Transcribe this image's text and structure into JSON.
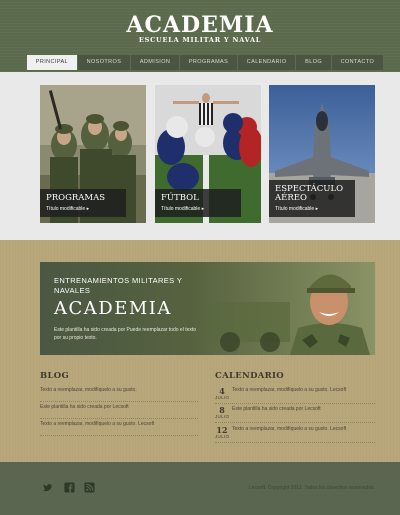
{
  "site": {
    "title": "ACADEMIA",
    "subtitle": "ESCUELA MILITAR Y NAVAL"
  },
  "nav": {
    "items": [
      {
        "label": "PRINCIPAL"
      },
      {
        "label": "NOSOTROS"
      },
      {
        "label": "ADMISION"
      },
      {
        "label": "PROGRAMAS"
      },
      {
        "label": "CALENDARIO"
      },
      {
        "label": "BLOG"
      },
      {
        "label": "CONTACTO"
      }
    ],
    "active_label": "PRINCIPAL"
  },
  "features": [
    {
      "title": "PROGRAMAS",
      "link": "Título modificable ▸"
    },
    {
      "title": "FÚTBOL",
      "link": "Título modificable ▸"
    },
    {
      "title": "ESPECTÁCULO AÉREO",
      "link": "Título modificable ▸"
    }
  ],
  "hero": {
    "kicker": "ENTRENAMIENTOS MILITARES Y NAVALES",
    "title": "ACADEMIA",
    "text": "Este plantilla ha sido creada por Puede reemplazar todo el texto por su propio texto."
  },
  "blog": {
    "title": "BLOG",
    "items": [
      "Texto a reemplazar, modifíquelo a su gusto.",
      "Este plantilla ha sido creada por Lecsoft",
      "Texto a reemplazar, modifíquelo a su gusto. Lecsoft"
    ]
  },
  "calendar": {
    "title": "CALENDARIO",
    "items": [
      {
        "day": "4",
        "month": "JULIO",
        "text": "Texto a reemplazar, modifíquelo a su gusto. Lecsoft"
      },
      {
        "day": "8",
        "month": "JULIO",
        "text": "Este plantilla ha sido creada por Lecsoft"
      },
      {
        "day": "12",
        "month": "JULIO",
        "text": "Texto a reemplazar, modifíquelo a su gusto. Lecsoft"
      }
    ]
  },
  "footer": {
    "copyright": "Lecsoft. Copyright 2012. Todos los derechos reservados.",
    "icons": [
      "twitter-icon",
      "facebook-icon",
      "rss-icon"
    ]
  },
  "colors": {
    "header": "#5b6a4c",
    "band": "#e9e9e9",
    "khaki": "#b9a77c",
    "footer": "#5a6650"
  }
}
